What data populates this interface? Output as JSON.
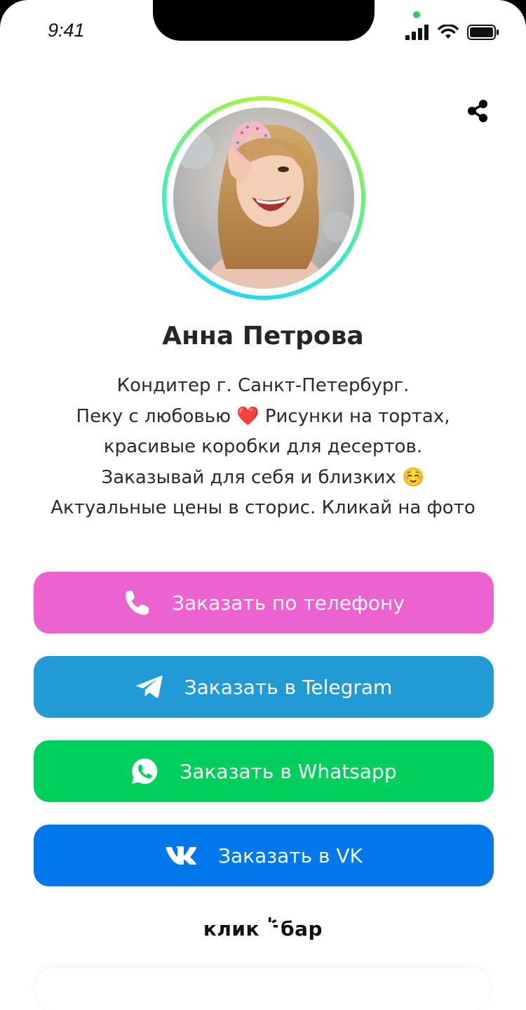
{
  "status_bar": {
    "time": "9:41"
  },
  "profile": {
    "name": "Анна Петрова",
    "bio_lines": [
      "Кондитер г. Санкт-Петербург.",
      "Пеку с любовью ❤️ Рисунки на тортах,",
      "красивые коробки для десертов.",
      "Заказывай для себя и близких ☺️",
      "Актуальные цены в сторис. Кликай на фото"
    ]
  },
  "buttons": [
    {
      "label": "Заказать по телефону",
      "icon": "phone-icon",
      "color": "#ec62cf"
    },
    {
      "label": "Заказать в Telegram",
      "icon": "telegram-icon",
      "color": "#219ad6"
    },
    {
      "label": "Заказать в Whatsapp",
      "icon": "whatsapp-icon",
      "color": "#00cf5b"
    },
    {
      "label": "Заказать в VK",
      "icon": "vk-icon",
      "color": "#0077ea"
    }
  ],
  "footer": {
    "logo_left": "клик",
    "logo_right": "бар"
  },
  "icons": {
    "share": "share-icon"
  }
}
